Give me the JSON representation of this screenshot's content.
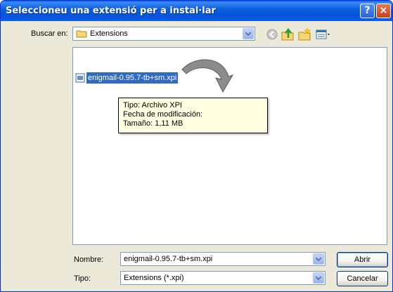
{
  "window": {
    "title": "Seleccioneu una extensió per a instal·lar",
    "help_label": "?",
    "close_label": "×"
  },
  "look_in": {
    "label": "Buscar en:",
    "value": "Extensions"
  },
  "toolbar": {
    "icons": [
      "back-icon",
      "up-folder-icon",
      "new-folder-icon",
      "view-menu-icon"
    ]
  },
  "files": [
    {
      "name": "enigmail-0.95.7-tb+sm.xpi",
      "selected": true
    }
  ],
  "tooltip": {
    "type": "Tipo: Archivo XPI",
    "modified": "Fecha de modificación:",
    "size": "Tamaño: 1,11 MB"
  },
  "filename": {
    "label": "Nombre:",
    "value": "enigmail-0.95.7-tb+sm.xpi"
  },
  "filetype": {
    "label": "Tipo:",
    "value": "Extensions (*.xpi)"
  },
  "buttons": {
    "open": "Abrir",
    "cancel": "Cancelar"
  },
  "colors": {
    "titlebar": "#0a5fe8",
    "dialog_bg": "#ece9d8",
    "selection": "#316ac5",
    "tooltip_bg": "#ffffe1"
  }
}
